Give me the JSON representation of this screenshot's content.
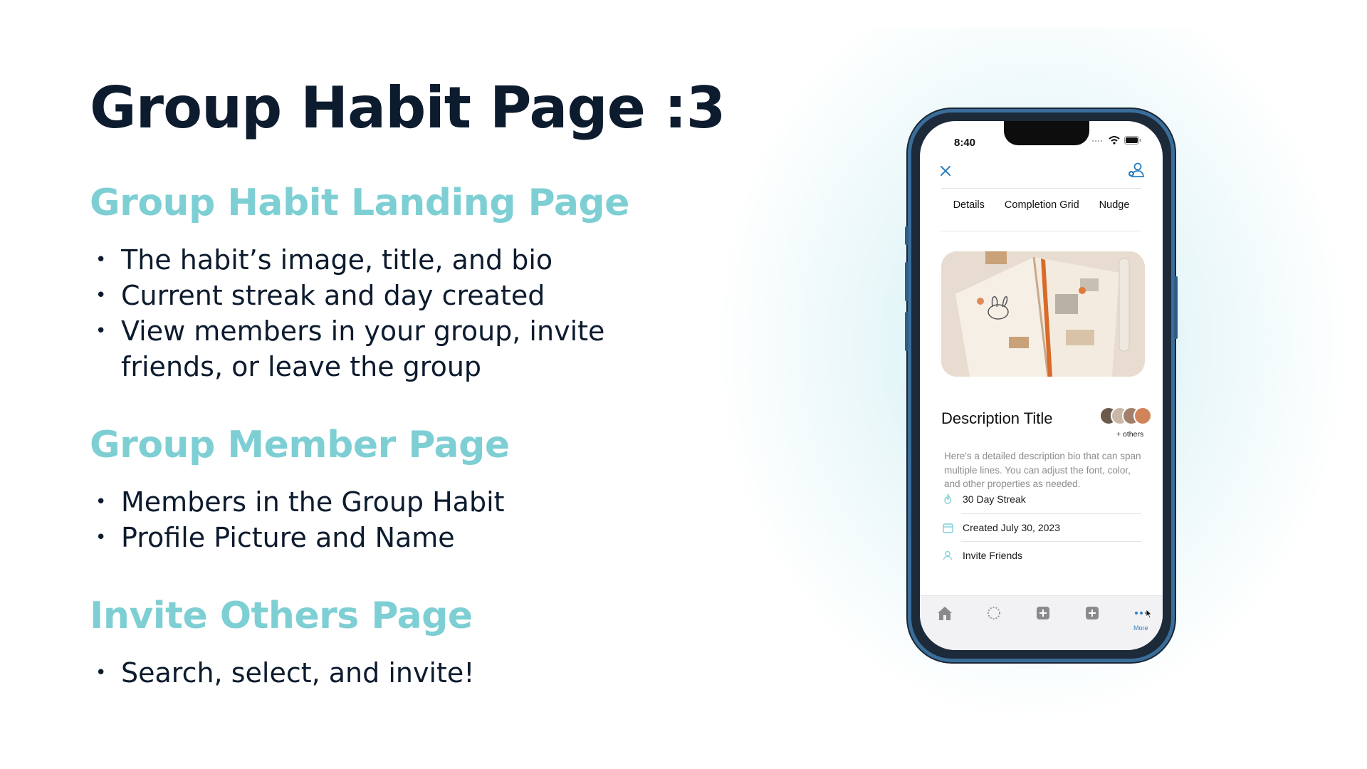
{
  "slide": {
    "title": "Group Habit Page :3",
    "sections": [
      {
        "heading": "Group Habit Landing Page",
        "bullets": [
          "The habit’s image, title, and bio",
          "Current streak and day created",
          "View members in your group, invite friends, or leave the group"
        ]
      },
      {
        "heading": "Group Member Page",
        "bullets": [
          "Members in the Group Habit",
          "Profile Picture and Name"
        ]
      },
      {
        "heading": "Invite Others Page",
        "bullets": [
          "Search, select, and invite!"
        ]
      }
    ]
  },
  "phone": {
    "status_bar": {
      "time": "8:40"
    },
    "tabs": [
      "Details",
      "Completion Grid",
      "Nudge"
    ],
    "description_title": "Description Title",
    "members_caption": "+ others",
    "bio": "Here's a detailed description bio that can span multiple lines. You can adjust the font, color, and other properties as needed.",
    "info_rows": [
      {
        "icon": "flame-icon",
        "label": "30 Day Streak"
      },
      {
        "icon": "calendar-icon",
        "label": "Created July 30, 2023"
      },
      {
        "icon": "person-icon",
        "label": "Invite Friends"
      }
    ],
    "tab_bar": {
      "items": [
        "home-icon",
        "progress-icon",
        "plus-square-icon",
        "plus-square-icon",
        "more-icon"
      ],
      "more_label": "More"
    },
    "colors": {
      "accent": "#2a7ec2",
      "heading": "#7ecfd4",
      "text": "#0d1b2e"
    }
  }
}
